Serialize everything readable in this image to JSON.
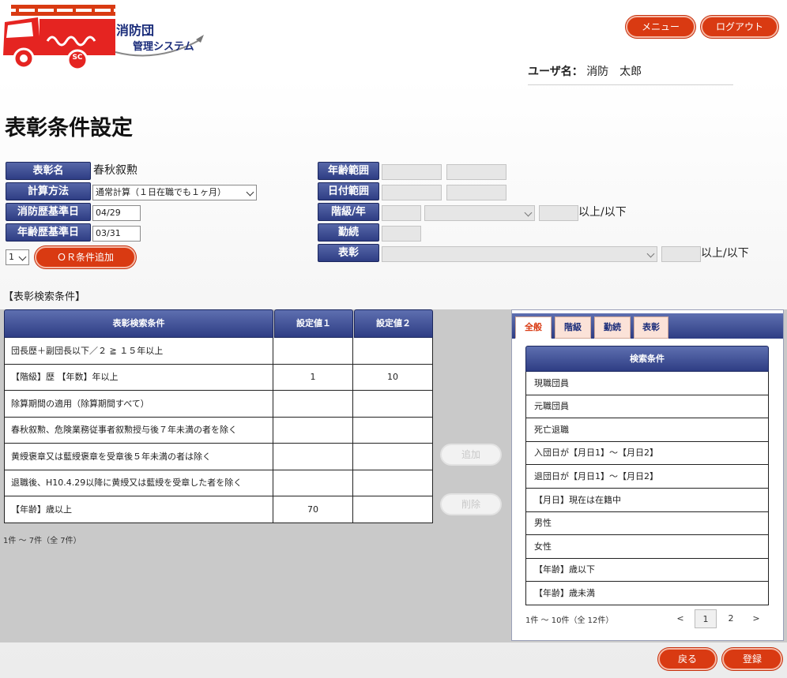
{
  "app": {
    "logo_line1": "消防団",
    "logo_line2": "管理システム",
    "logo_emblem": "SC"
  },
  "header": {
    "menu_label": "メニュー",
    "logout_label": "ログアウト",
    "user_key": "ユーザ名：",
    "user_name": "消防　太郎"
  },
  "page_title": "表彰条件設定",
  "form": {
    "award_name_label": "表彰名",
    "award_name_value": "春秋叙勲",
    "calc_method_label": "計算方法",
    "calc_method_value": "通常計算（１日在職でも１ヶ月）",
    "fire_service_base_label": "消防歴基準日",
    "fire_service_base_value": "04/29",
    "age_base_label": "年齢歴基準日",
    "age_base_value": "03/31",
    "or_group_value": "1",
    "or_add_label": "ＯＲ条件追加",
    "age_range_label": "年齢範囲",
    "date_range_label": "日付範囲",
    "rank_year_label": "階級/年",
    "rank_suffix": "以上/以下",
    "service_label": "勤続",
    "award_label": "表彰",
    "award_suffix": "以上/以下"
  },
  "conditions_section_title": "【表彰検索条件】",
  "conditions_table": {
    "headers": [
      "表彰検索条件",
      "設定値１",
      "設定値２"
    ],
    "rows": [
      [
        "団長歴＋副団長以下／２ ≧ １５年以上",
        "",
        ""
      ],
      [
        "【階級】歴 【年数】年以上",
        "1",
        "10"
      ],
      [
        "除算期間の適用（除算期間すべて）",
        "",
        ""
      ],
      [
        "春秋叙勲、危険業務従事者叙勲授与後７年未満の者を除く",
        "",
        ""
      ],
      [
        "黄綬褒章又は藍綬褒章を受章後５年未満の者は除く",
        "",
        ""
      ],
      [
        "退職後、H10.4.29以降に黄綬又は藍綬を受章した者を除く",
        "",
        ""
      ],
      [
        "【年齢】歳以上",
        "70",
        ""
      ]
    ],
    "count_text": "1件 ～ 7件（全 7件）"
  },
  "middle_buttons": {
    "add_label": "追加",
    "delete_label": "削除"
  },
  "right_panel": {
    "tabs": [
      "全般",
      "階級",
      "勤続",
      "表彰"
    ],
    "active_tab": "全般",
    "header": "検索条件",
    "items": [
      "現職団員",
      "元職団員",
      "死亡退職",
      "入団日が【月日1】～【月日2】",
      "退団日が【月日1】～【月日2】",
      "【月日】現在は在籍中",
      "男性",
      "女性",
      "【年齢】歳以下",
      "【年齢】歳未満"
    ],
    "count_text": "1件 ～ 10件（全 12件）",
    "pager": {
      "prev": "<",
      "pages": [
        "1",
        "2"
      ],
      "current": "1",
      "next": ">"
    }
  },
  "footer": {
    "back_label": "戻る",
    "register_label": "登録"
  },
  "colors": {
    "accent_red": "#d93a12",
    "header_navy": "#2e3d84",
    "work_grey": "#c9c9c9"
  }
}
